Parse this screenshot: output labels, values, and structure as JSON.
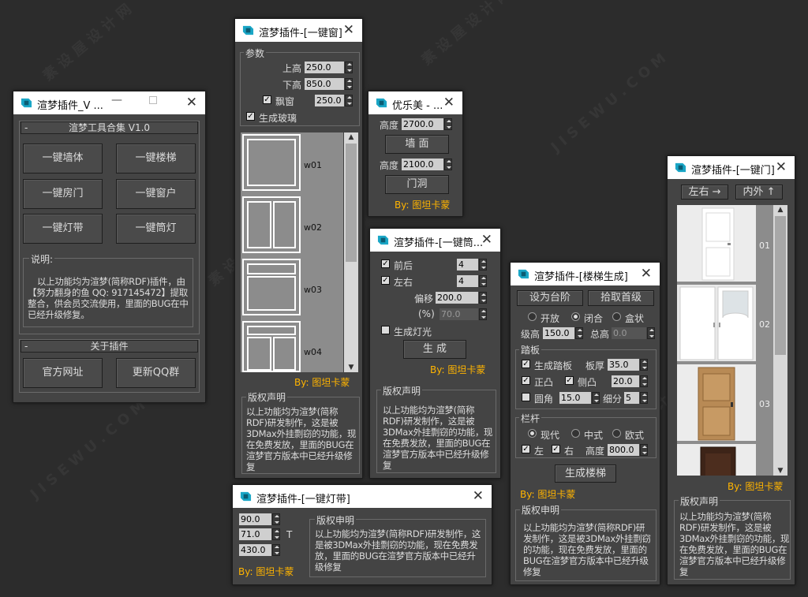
{
  "wm": {
    "a": "素 设 屋 设 计 网",
    "b": "J I S E W U . C O M"
  },
  "tools": {
    "title": "渲梦插件_V ...",
    "g1": "渲梦工具合集 V1.0",
    "b1": "一键墙体",
    "b2": "一键楼梯",
    "b3": "一键房门",
    "b4": "一键窗户",
    "b5": "一键灯带",
    "b6": "一键筒灯",
    "desc_label": "说明:",
    "desc": "以上功能均为渲梦(简称RDF)插件，由【努力翻身的鱼 QQ: 917145472】提取整合，供会员交流使用，里面的BUG在中已经升级修复。",
    "g2": "关于插件",
    "b7": "官方网址",
    "b8": "更新QQ群"
  },
  "win": {
    "title": "渲梦插件-[一键窗]",
    "params": "参数",
    "top": "上高",
    "top_v": "250.0",
    "bottom": "下高",
    "bottom_v": "850.0",
    "bay": "飘窗",
    "bay_v": "250.0",
    "glass": "生成玻璃",
    "items": [
      "w01",
      "w02",
      "w03",
      "w04"
    ],
    "by": "By: 图坦卡蒙",
    "copy": "版权声明",
    "copy_t": "以上功能均为渲梦(简称RDF)研发制作，这是被3DMax外挂剽窃的功能，现在免费发放，里面的BUG在渲梦官方版本中已经升级修复"
  },
  "yl": {
    "title": "优乐美 - ...",
    "h1": "高度",
    "h1v": "2700.0",
    "wall": "墙 面",
    "h2": "高度",
    "h2v": "2100.0",
    "hole": "门洞",
    "by": "By: 图坦卡蒙"
  },
  "dl": {
    "title": "渲梦插件-[一键筒...",
    "front": "前后",
    "front_v": "4",
    "lr": "左右",
    "lr_v": "4",
    "off": "偏移",
    "off_v": "200.0",
    "pct": "(%)",
    "pct_v": "70.0",
    "light": "生成灯光",
    "gen": "生 成",
    "by": "By: 图坦卡蒙",
    "copy": "版权声明",
    "copy_t": "以上功能均为渲梦(简称RDF)研发制作，这是被3DMax外挂剽窃的功能，现在免费发放，里面的BUG在渲梦官方版本中已经升级修复"
  },
  "st": {
    "title": "渲梦插件-[楼梯生成]",
    "set": "设为台阶",
    "pick": "拾取首级",
    "open": "开放",
    "closed": "闭合",
    "box": "盒状",
    "step_h": "级高",
    "step_hv": "150.0",
    "total": "总高",
    "total_v": "0.0",
    "tread": "踏板",
    "gen_tread": "生成踏板",
    "thick": "板厚",
    "thick_v": "35.0",
    "front": "正凸",
    "side": "侧凸",
    "side_v": "20.0",
    "round": "圆角",
    "round_v": "15.0",
    "seg": "细分",
    "seg_v": "5",
    "rail": "栏杆",
    "modern": "现代",
    "chinese": "中式",
    "euro": "欧式",
    "left": "左",
    "right": "右",
    "height": "高度",
    "height_v": "800.0",
    "gen": "生成楼梯",
    "by": "By: 图坦卡蒙",
    "copy": "版权申明",
    "copy_t": "以上功能均为渲梦(简称RDF)研发制作，这是被3DMax外挂剽窃的功能，现在免费发放，里面的BUG在渲梦官方版本中已经升级修复"
  },
  "door": {
    "title": "渲梦插件-[一键门]",
    "lr": "左右 →",
    "io": "内外 ↑",
    "items": [
      "01",
      "02",
      "03"
    ],
    "by": "By: 图坦卡蒙",
    "copy": "版权声明",
    "copy_t": "以上功能均为渲梦(简称RDF)研发制作，这是被3DMax外挂剽窃的功能，现在免费发放，里面的BUG在渲梦官方版本中已经升级修复"
  },
  "strip": {
    "title": "渲梦插件-[一键灯带]",
    "v1": "90.0",
    "v2": "71.0",
    "v3": "430.0",
    "t": "T",
    "by": "By: 图坦卡蒙",
    "copy": "版权申明",
    "copy_t": "以上功能均为渲梦(简称RDF)研发制作，这是被3DMax外挂剽窃的功能，现在免费发放，里面的BUG在渲梦官方版本中已经升级修复"
  }
}
